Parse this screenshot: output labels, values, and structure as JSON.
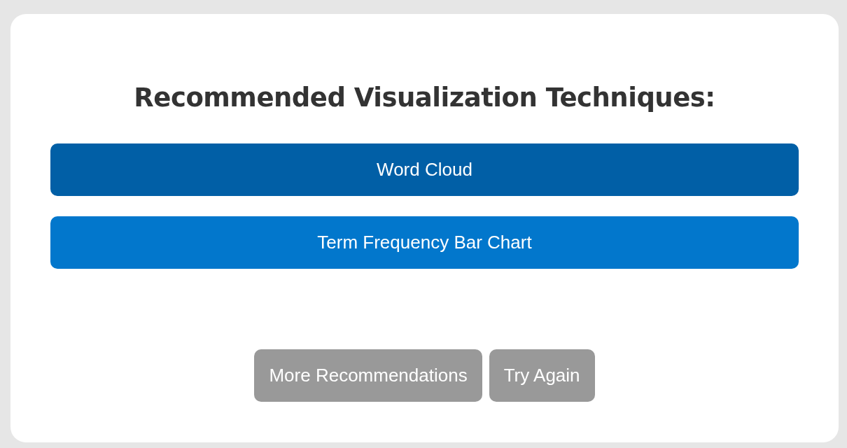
{
  "title": "Recommended Visualization Techniques:",
  "recommendations": [
    {
      "label": "Word Cloud",
      "selected": true
    },
    {
      "label": "Term Frequency Bar Chart",
      "selected": false
    }
  ],
  "actions": [
    {
      "label": "More Recommendations"
    },
    {
      "label": "Try Again"
    }
  ]
}
